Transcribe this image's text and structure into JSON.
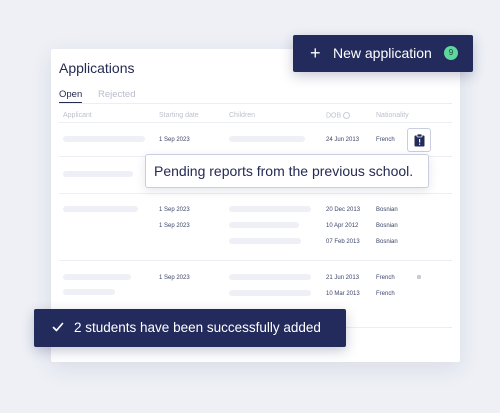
{
  "card": {
    "title": "Applications",
    "tabs": [
      {
        "label": "Open",
        "active": true
      },
      {
        "label": "Rejected",
        "active": false
      }
    ],
    "columns": {
      "applicant": "Applicant",
      "starting_date": "Starting date",
      "children": "Children",
      "dob": "DOB",
      "nationality": "Nationality"
    },
    "rows": [
      {
        "starting_date": "1 Sep 2023",
        "dobs": [
          "24 Jun 2013"
        ],
        "nationalities": [
          "French"
        ]
      },
      {
        "starting_date": "",
        "dobs": [],
        "nationalities": []
      },
      {
        "starting_date": "1 Sep 2023",
        "starting_date_2": "1 Sep 2023",
        "dobs": [
          "20 Dec 2013",
          "10 Apr 2012",
          "07 Feb 2013"
        ],
        "nationalities": [
          "Bosnian",
          "Bosnian",
          "Bosnian"
        ]
      },
      {
        "starting_date": "1 Sep 2023",
        "dobs": [
          "21 Jun 2013",
          "10 Mar 2013"
        ],
        "nationalities": [
          "French",
          "French"
        ]
      }
    ]
  },
  "tooltip": {
    "text": "Pending reports from the previous school."
  },
  "new_application": {
    "label": "New application",
    "count": "9",
    "icon": "plus-icon"
  },
  "toast": {
    "text": "2 students have been successfully added",
    "icon": "check-icon"
  },
  "colors": {
    "navy": "#232a5c",
    "badge_green": "#5fd69e",
    "background": "#eef0f6"
  }
}
